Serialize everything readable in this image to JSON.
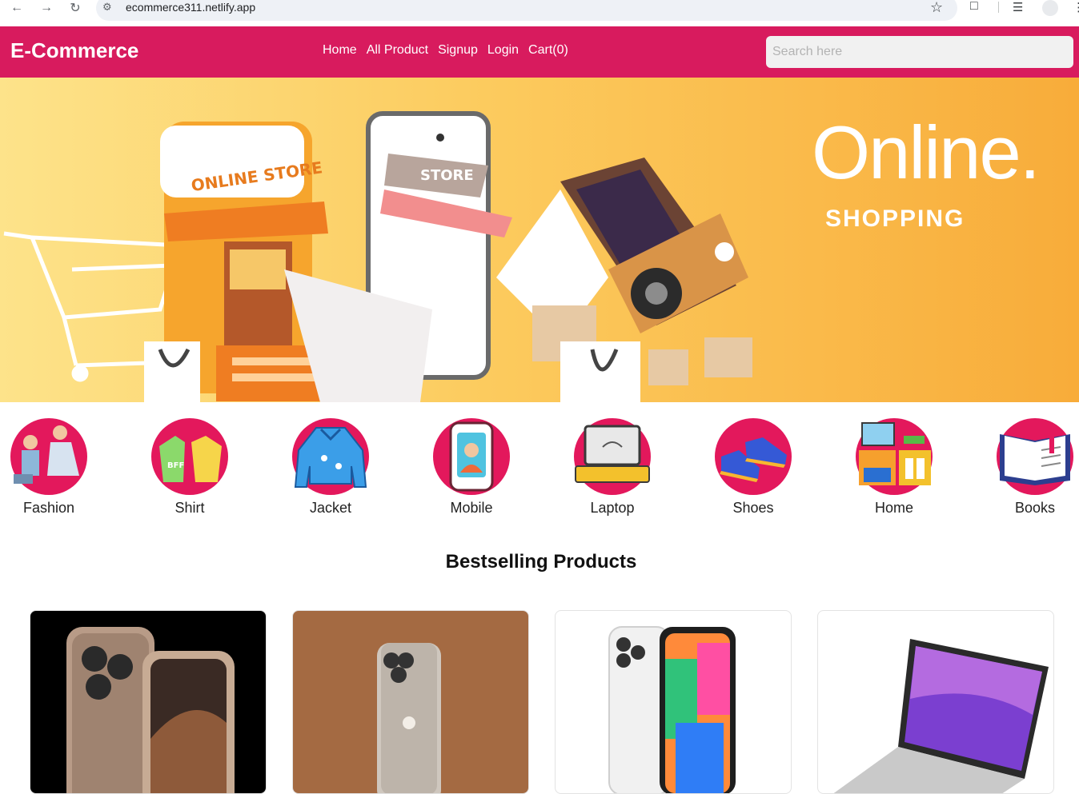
{
  "browser": {
    "url": "ecommerce311.netlify.app"
  },
  "navbar": {
    "brand": "E-Commerce",
    "links": [
      "Home",
      "All Product",
      "Signup",
      "Login",
      "Cart(0)"
    ],
    "search_placeholder": "Search here"
  },
  "hero": {
    "title": "Online.",
    "subtitle": "SHOPPING"
  },
  "categories": [
    "Fashion",
    "Shirt",
    "Jacket",
    "Mobile",
    "Laptop",
    "Shoes",
    "Home",
    "Books"
  ],
  "bestselling": {
    "title": "Bestselling Products"
  },
  "colors": {
    "brand": "#d81b5e",
    "category_circle": "#e3185c",
    "hero_start": "#fde38a",
    "hero_end": "#f8ac3a"
  }
}
